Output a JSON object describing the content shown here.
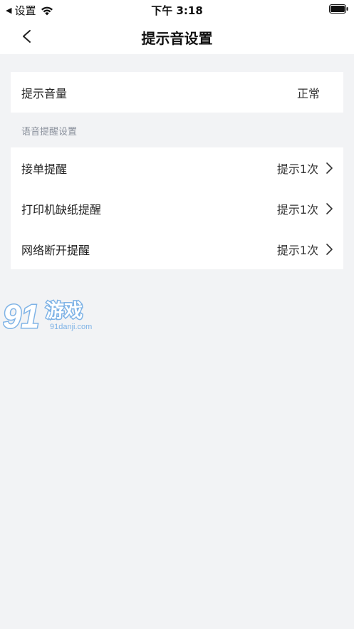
{
  "status_bar": {
    "back_app": "设置",
    "time": "下午 3:18"
  },
  "nav": {
    "title": "提示音设置"
  },
  "volume": {
    "label": "提示音量",
    "value": "正常"
  },
  "section": {
    "label": "语音提醒设置"
  },
  "reminders": [
    {
      "label": "接单提醒",
      "value": "提示1次"
    },
    {
      "label": "打印机缺纸提醒",
      "value": "提示1次"
    },
    {
      "label": "网络断开提醒",
      "value": "提示1次"
    }
  ],
  "watermark": {
    "brand": "游戏",
    "number": "91",
    "site": "91danji.com"
  },
  "colors": {
    "background": "#f2f3f5",
    "card": "#ffffff",
    "section_label": "#8a909c",
    "watermark": "#7fb3e6"
  }
}
